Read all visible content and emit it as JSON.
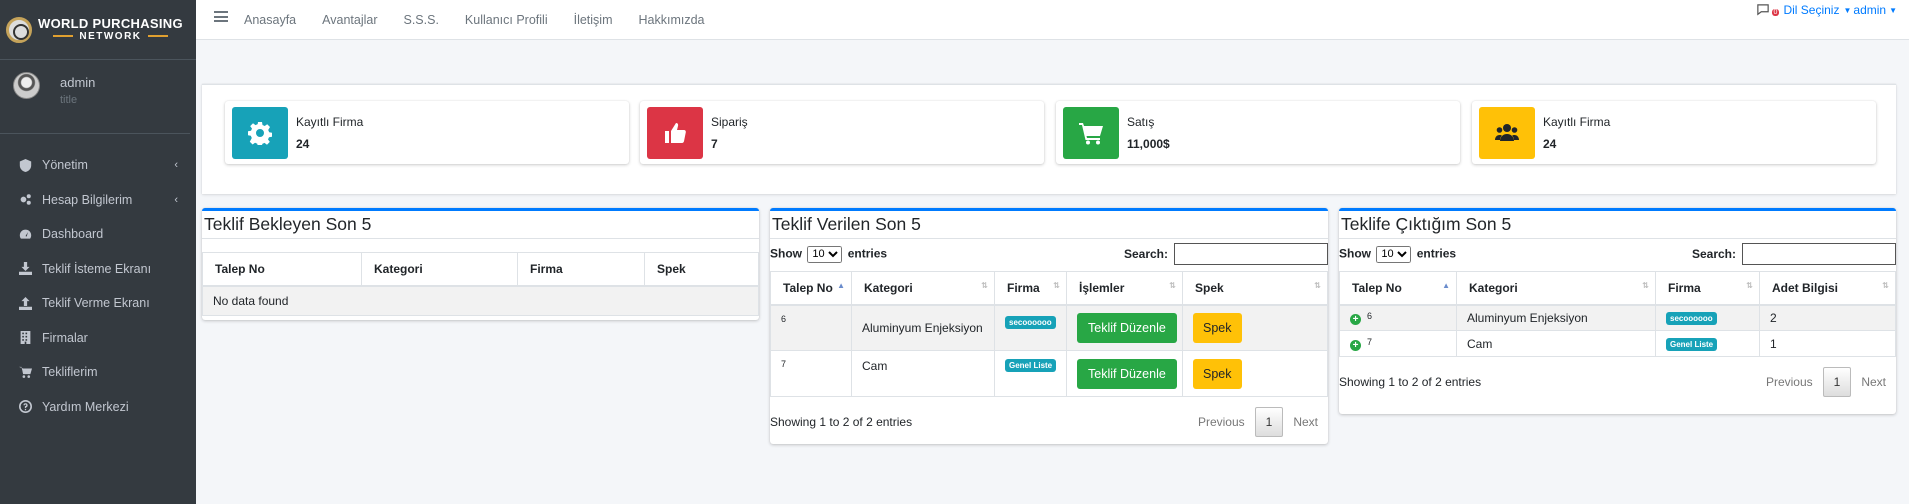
{
  "brand": {
    "line1": "WORLD PURCHASING",
    "line2": "NETWORK"
  },
  "user": {
    "name": "admin",
    "title": "title"
  },
  "sidebar": {
    "items": [
      {
        "label": "Yönetim",
        "icon": "shield-icon",
        "has_children": true
      },
      {
        "label": "Hesap Bilgilerim",
        "icon": "gears-icon",
        "has_children": true
      },
      {
        "label": "Dashboard",
        "icon": "tachometer-icon",
        "has_children": false
      },
      {
        "label": "Teklif İsteme Ekranı",
        "icon": "download-icon",
        "has_children": false
      },
      {
        "label": "Teklif Verme Ekranı",
        "icon": "upload-icon",
        "has_children": false
      },
      {
        "label": "Firmalar",
        "icon": "building-icon",
        "has_children": false
      },
      {
        "label": "Tekliflerim",
        "icon": "cart-icon",
        "has_children": false
      },
      {
        "label": "Yardım Merkezi",
        "icon": "question-circle-icon",
        "has_children": false
      }
    ],
    "chevron": "‹"
  },
  "topnav": {
    "links": [
      "Anasayfa",
      "Avantajlar",
      "S.S.S.",
      "Kullanıcı Profili",
      "İletişim",
      "Hakkımızda"
    ],
    "message_count": "0",
    "language_label": "Dil Seçiniz",
    "user_label": "admin"
  },
  "stats": [
    {
      "label": "Kayıtlı Firma",
      "value": "24",
      "color": "#17a2b8",
      "icon": "gear-icon"
    },
    {
      "label": "Sipariş",
      "value": "7",
      "color": "#dc3545",
      "icon": "thumbs-up-icon"
    },
    {
      "label": "Satış",
      "value": "11,000$",
      "color": "#28a745",
      "icon": "cart-icon"
    },
    {
      "label": "Kayıtlı Firma",
      "value": "24",
      "color": "#ffc107",
      "icon": "users-icon"
    }
  ],
  "panel1": {
    "title": "Teklif Bekleyen Son 5",
    "columns": [
      "Talep No",
      "Kategori",
      "Firma",
      "Spek"
    ],
    "empty": "No data found"
  },
  "panel2": {
    "title": "Teklif Verilen Son 5",
    "show_label": "Show",
    "entries_label": "entries",
    "page_size": "10",
    "search_label": "Search:",
    "columns": [
      "Talep No",
      "Kategori",
      "Firma",
      "İşlemler",
      "Spek"
    ],
    "rows": [
      {
        "id": "6",
        "category": "Aluminyum Enjeksiyon",
        "firm": "secoooooo",
        "action": "Teklif Düzenle",
        "spec": "Spek"
      },
      {
        "id": "7",
        "category": "Cam",
        "firm": "Genel Liste",
        "action": "Teklif Düzenle",
        "spec": "Spek"
      }
    ],
    "info": "Showing 1 to 2 of 2 entries",
    "prev": "Previous",
    "page": "1",
    "next": "Next"
  },
  "panel3": {
    "title": "Teklife Çıktığım Son 5",
    "show_label": "Show",
    "entries_label": "entries",
    "page_size": "10",
    "search_label": "Search:",
    "columns": [
      "Talep No",
      "Kategori",
      "Firma",
      "Adet Bilgisi"
    ],
    "rows": [
      {
        "id": "6",
        "category": "Aluminyum Enjeksiyon",
        "firm": "secoooooo",
        "qty": "2"
      },
      {
        "id": "7",
        "category": "Cam",
        "firm": "Genel Liste",
        "qty": "1"
      }
    ],
    "info": "Showing 1 to 2 of 2 entries",
    "prev": "Previous",
    "page": "1",
    "next": "Next"
  }
}
